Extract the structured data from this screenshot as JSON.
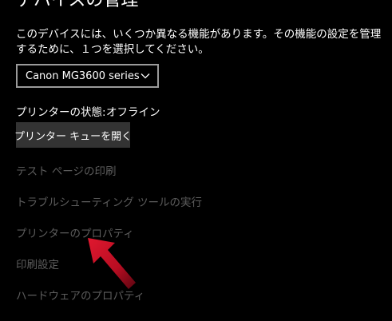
{
  "header": {
    "title": "デバイスの管理"
  },
  "description": "このデバイスには、いくつか異なる機能があります。その機能の設定を管理するために、１つを選択してください。",
  "device_select": {
    "selected": "Canon MG3600 series"
  },
  "printer_status": {
    "label": "プリンターの状態:",
    "value": "オフライン"
  },
  "queue_button": {
    "label": "プリンター キューを開く"
  },
  "links": [
    {
      "label": "テスト ページの印刷"
    },
    {
      "label": "トラブルシューティング ツールの実行"
    },
    {
      "label": "プリンターのプロパティ"
    },
    {
      "label": "印刷設定"
    },
    {
      "label": "ハードウェアのプロパティ"
    }
  ],
  "colors": {
    "background": "#000000",
    "text": "#ffffff",
    "disabled_link": "#5c5c5c",
    "button_bg": "#333333",
    "select_border": "#9a9a9a",
    "annotation_arrow": "#c8102e"
  },
  "icons": {
    "dropdown": "chevron-down-icon",
    "annotation": "red-arrow-annotation"
  }
}
